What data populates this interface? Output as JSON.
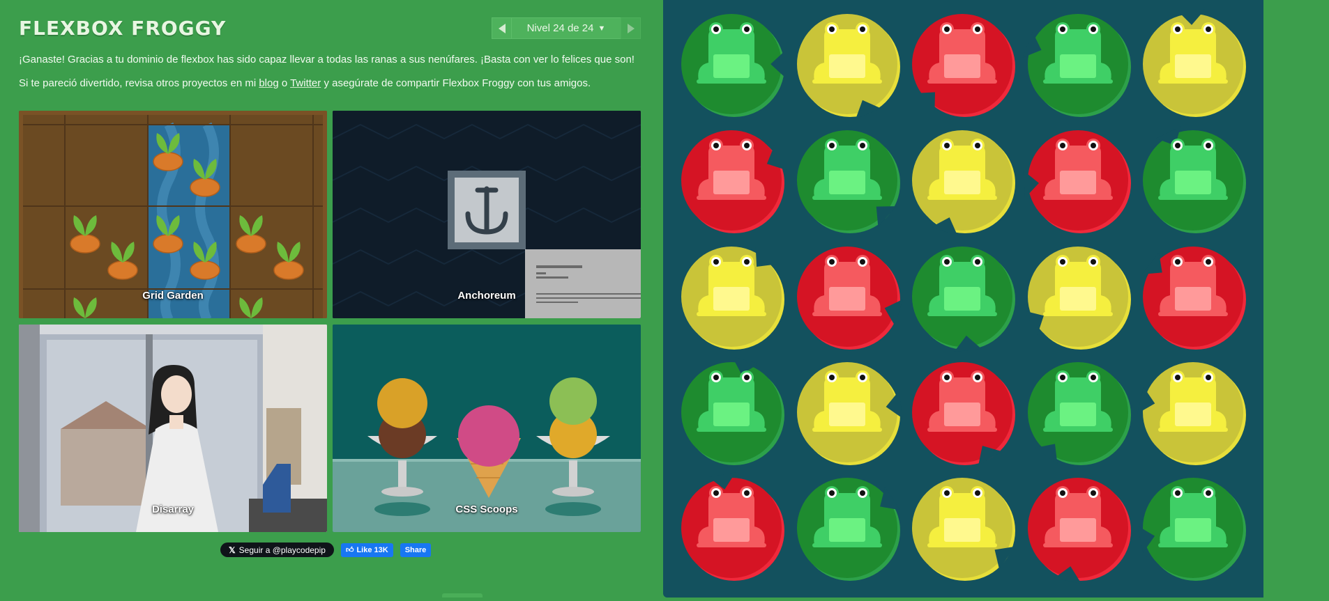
{
  "header": {
    "title": "FLEXBOX FROGGY",
    "level_label": "Nivel 24 de 24",
    "caret": "▼"
  },
  "message": {
    "win": "¡Ganaste! Gracias a tu dominio de flexbox has sido capaz llevar a todas las ranas a sus nenúfares. ¡Basta con ver lo felices que son!",
    "more_prefix": "Si te pareció divertido, revisa otros proyectos en mi ",
    "blog_link": "blog",
    "more_middle": " o ",
    "twitter_link": "Twitter",
    "more_suffix": " y asegúrate de compartir Flexbox Froggy con tus amigos."
  },
  "projects": [
    {
      "label": "Grid Garden"
    },
    {
      "label": "Anchoreum"
    },
    {
      "label": "Disarray"
    },
    {
      "label": "CSS Scoops"
    }
  ],
  "social": {
    "x_mark": "𝕏",
    "x_follow": "Seguir a @playcodepip",
    "fb_like": "Like 13K",
    "fb_share": "Share"
  },
  "colors": {
    "green": {
      "pad": "#1e8b2f",
      "rim": "#2da14a",
      "frog": "#3fcf66",
      "belly": "#6bf282"
    },
    "yellow": {
      "pad": "#c9c439",
      "rim": "#e7df3a",
      "frog": "#f5ef3f",
      "belly": "#fff98e"
    },
    "red": {
      "pad": "#d51424",
      "rim": "#f0293b",
      "frog": "#f55a5f",
      "belly": "#ff9a9a"
    }
  },
  "board": [
    [
      "green",
      "yellow",
      "red",
      "green",
      "yellow"
    ],
    [
      "red",
      "green",
      "yellow",
      "red",
      "green"
    ],
    [
      "yellow",
      "red",
      "green",
      "yellow",
      "red"
    ],
    [
      "green",
      "yellow",
      "red",
      "green",
      "yellow"
    ],
    [
      "red",
      "green",
      "yellow",
      "red",
      "green"
    ]
  ]
}
